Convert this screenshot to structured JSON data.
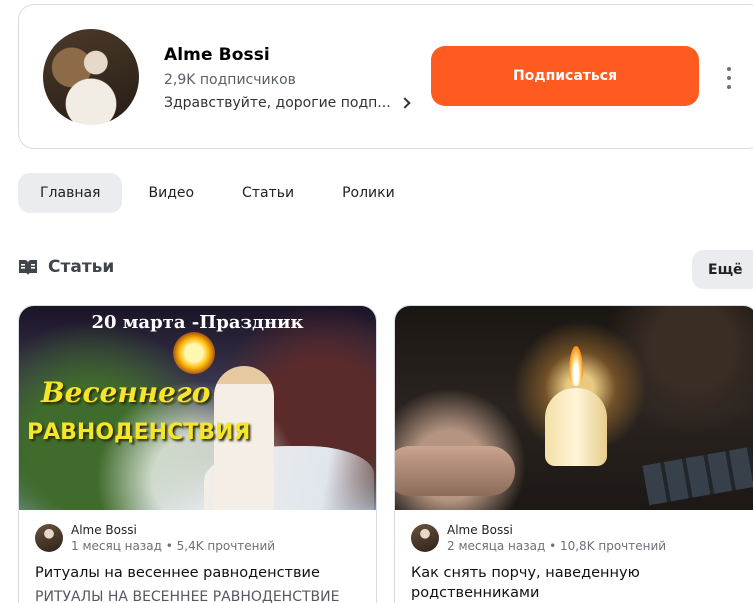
{
  "channel": {
    "name": "Alme Bossi",
    "subscribers": "2,9K подписчиков",
    "description": "Здравствуйте, дорогие подп...",
    "subscribe_label": "Подписаться",
    "accent_color": "#ff5a1f"
  },
  "tabs": [
    {
      "label": "Главная",
      "active": true
    },
    {
      "label": "Видео",
      "active": false
    },
    {
      "label": "Статьи",
      "active": false
    },
    {
      "label": "Ролики",
      "active": false
    }
  ],
  "section": {
    "title": "Статьи",
    "icon": "book-icon",
    "more_label": "Ещё"
  },
  "articles": [
    {
      "thumb_line1": "20 марта -Праздник",
      "thumb_line2": "Весеннего",
      "thumb_line3": "РАВНОДЕНСТВИЯ",
      "author": "Alme Bossi",
      "stats": "1 месяц назад • 5,4K прочтений",
      "title": "Ритуалы на весеннее равноденствие",
      "excerpt": "РИТУАЛЫ НА ВЕСЕННЕЕ РАВНОДЕНСТВИЕ"
    },
    {
      "author": "Alme Bossi",
      "stats": "2 месяца назад • 10,8K прочтений",
      "title": "Как снять порчу, наведенную родственниками"
    }
  ]
}
